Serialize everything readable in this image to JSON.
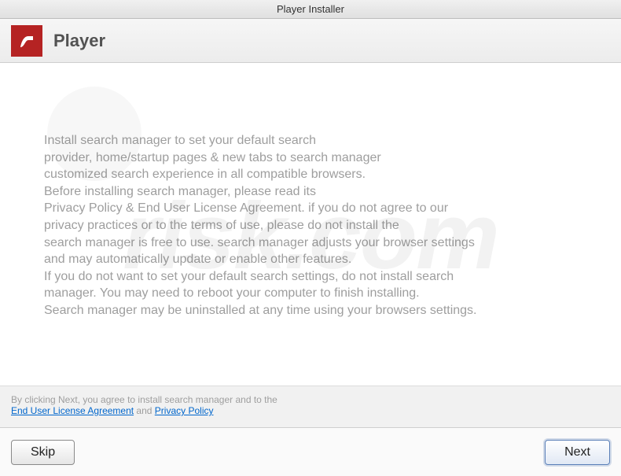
{
  "titlebar": {
    "title": "Player Installer"
  },
  "header": {
    "app_name": "Player"
  },
  "body": {
    "line1": "Install search manager to set your default search",
    "line2": "provider, home/startup pages & new tabs to search manager",
    "line3": "customized search experience in all compatible browsers.",
    "line4": "Before installing search manager, please read its",
    "line5": "Privacy Policy & End User License Agreement. if you do not agree to our",
    "line6": "privacy practices or to the terms of use, please do not install the",
    "line7": "search manager is free to use. search manager adjusts your browser settings",
    "line8": "and may automatically update or enable other features.",
    "line9": "If you do not want to set your default search settings, do not install search",
    "line10": "manager. You may need to reboot your computer to finish installing.",
    "line11": "Search manager may be uninstalled at any time using your browsers settings."
  },
  "agreement": {
    "text": "By clicking Next, you agree to install search manager and to the",
    "eula": "End User License Agreement",
    "and": " and ",
    "privacy": "Privacy Policy"
  },
  "footer": {
    "skip": "Skip",
    "next": "Next"
  },
  "watermark": {
    "text": "risk.com"
  }
}
